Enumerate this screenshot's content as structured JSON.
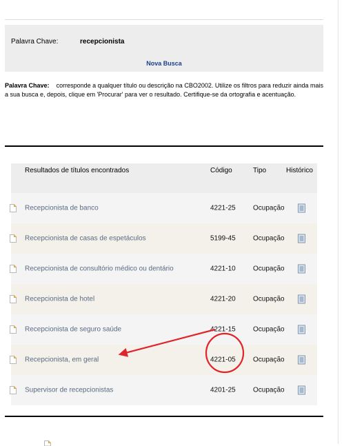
{
  "search": {
    "keyword_label": "Palavra Chave:",
    "keyword_value": "recepcionista",
    "new_search_link": "Nova Busca"
  },
  "help": {
    "label": "Palavra Chave:",
    "text": "corresponde a qualquer título ou descrição na CBO2002. Utilize os filtros para reduzir ainda mais a sua busca e, depois, clique em 'Procurar' para ver o resultado. Certifique-se da ortografia e acentuação."
  },
  "results": {
    "columns": {
      "title": "Resultados de títulos encontrados",
      "code": "Código",
      "type": "Tipo",
      "history": "Histórico"
    },
    "rows": [
      {
        "title": "Recepcionista de banco",
        "code": "4221-25",
        "type": "Ocupação"
      },
      {
        "title": "Recepcionista de casas de espetáculos",
        "code": "5199-45",
        "type": "Ocupação"
      },
      {
        "title": "Recepcionista de consultório médico ou dentário",
        "code": "4221-10",
        "type": "Ocupação"
      },
      {
        "title": "Recepcionista de hotel",
        "code": "4221-20",
        "type": "Ocupação"
      },
      {
        "title": "Recepcionista de seguro saúde",
        "code": "4221-15",
        "type": "Ocupação"
      },
      {
        "title": "Recepcionista, em geral",
        "code": "4221-05",
        "type": "Ocupação"
      },
      {
        "title": "Supervisor de recepcionistas",
        "code": "4201-25",
        "type": "Ocupação"
      }
    ]
  },
  "icons": {
    "row_icon": "page-icon",
    "history_icon": "document-list-icon",
    "annotation": "red-arrow-and-circle"
  },
  "colors": {
    "panel_bg": "#ededed",
    "link": "#1a3e8c",
    "result_text": "#586b82",
    "annotation": "#e0242a"
  }
}
